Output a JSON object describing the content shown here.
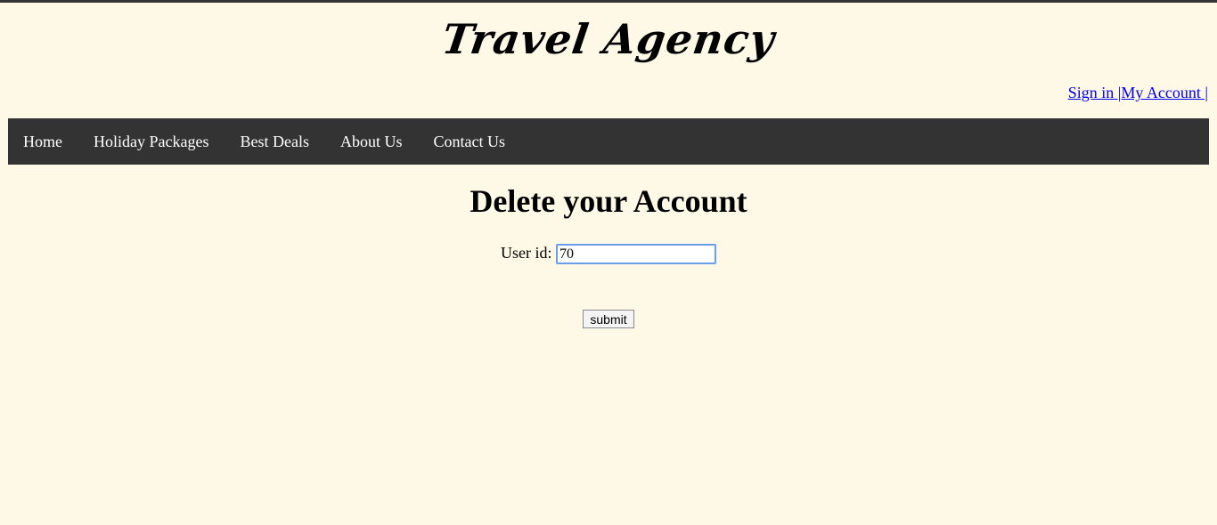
{
  "header": {
    "logo_text": "Travel Agency",
    "links": [
      {
        "label": "Sign in |"
      },
      {
        "label": "My Account |"
      }
    ]
  },
  "nav": {
    "items": [
      {
        "label": "Home"
      },
      {
        "label": "Holiday Packages"
      },
      {
        "label": "Best Deals"
      },
      {
        "label": "About Us"
      },
      {
        "label": "Contact Us"
      }
    ]
  },
  "main": {
    "title": "Delete your Account",
    "user_id_label": "User id:",
    "user_id_value": "70",
    "submit_label": "submit"
  },
  "colors": {
    "background": "#fef8e6",
    "nav_background": "#333333",
    "link": "#0000ee",
    "input_focus_border": "#6a9ee8"
  }
}
